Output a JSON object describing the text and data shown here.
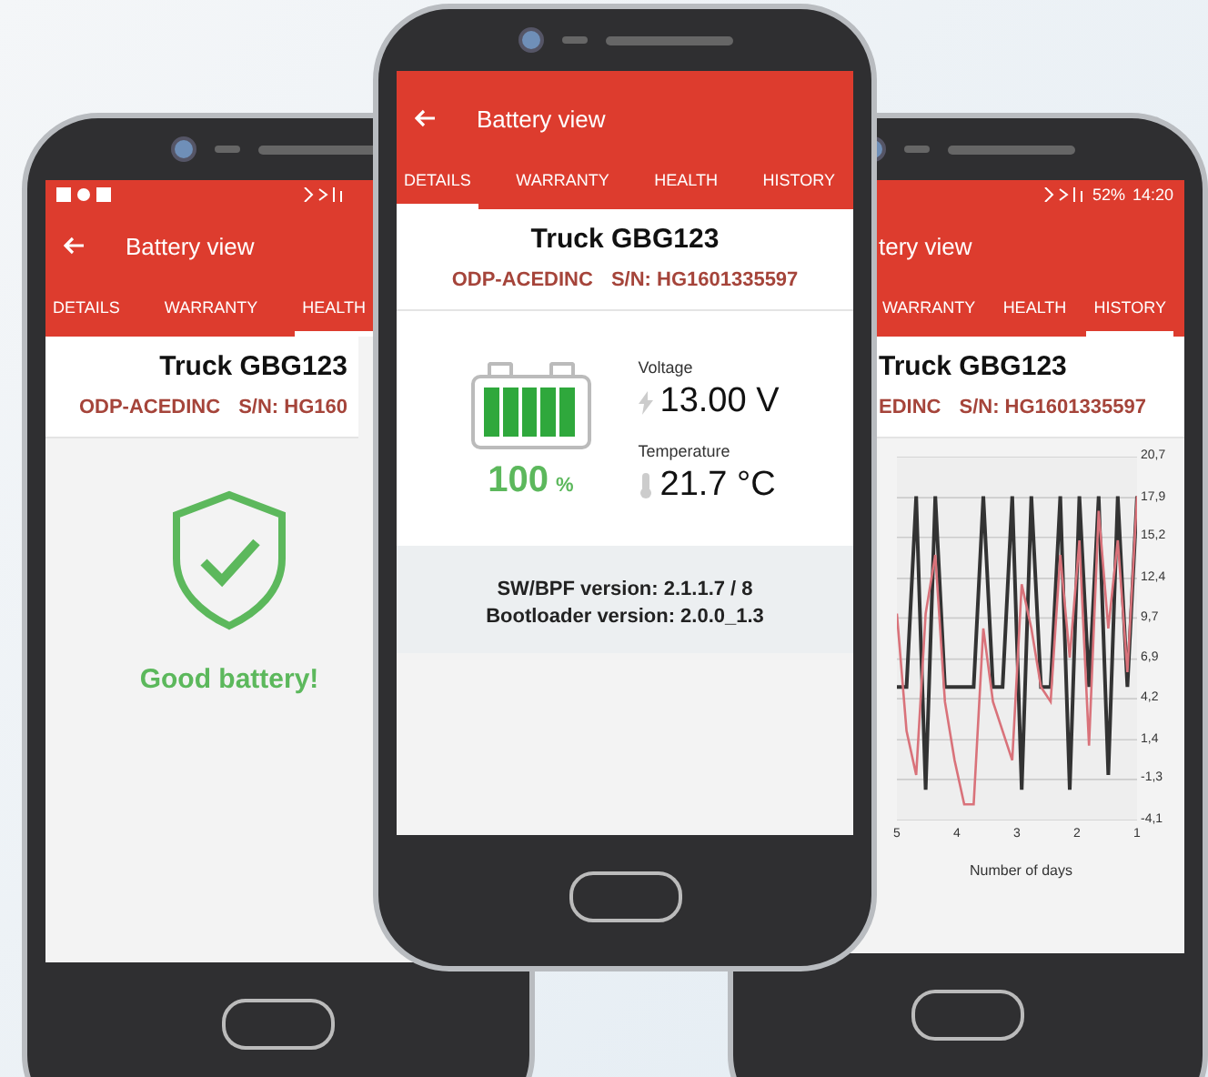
{
  "phones": [
    {
      "kind": "warranty",
      "title": "Battery view",
      "tabs": [
        {
          "label": "DETAILS",
          "selected": false
        },
        {
          "label": "WARRANTY",
          "selected": false
        },
        {
          "label": "HEALTH",
          "selected": true
        }
      ],
      "vehicle": "Truck GBG123",
      "model": "ODP-ACEDINC",
      "serial": "S/N: HG160",
      "message": "Good battery!"
    },
    {
      "kind": "details",
      "title": "Battery view",
      "tabs": [
        {
          "label": "DETAILS",
          "selected": true
        },
        {
          "label": "WARRANTY",
          "selected": false
        },
        {
          "label": "HEALTH",
          "selected": false
        },
        {
          "label": "HISTORY",
          "selected": false
        }
      ],
      "vehicle": "Truck GBG123",
      "model": "ODP-ACEDINC",
      "serial": "S/N: HG1601335597",
      "charge": "100",
      "charge_unit": "%",
      "level": 1,
      "voltage_label": "Voltage",
      "voltage": "13.00 V",
      "temperature_label": "Temperature",
      "temperature": "21.7 °C",
      "versions": [
        "SW/BPF version: 2.1.1.7 / 8",
        "Bootloader version: 2.0.0_1.3"
      ]
    },
    {
      "kind": "history",
      "title": "tery view",
      "status_texts": [
        "52%",
        "14:20"
      ],
      "tabs": [
        {
          "label": "WARRANTY",
          "selected": false
        },
        {
          "label": "HEALTH",
          "selected": false
        },
        {
          "label": "HISTORY",
          "selected": true
        }
      ],
      "vehicle": "Truck GBG123",
      "model": "EDINC",
      "serial": "S/N: HG1601335597",
      "chart_data": {
        "type": "line",
        "xlabel": "Number of days",
        "grid": true,
        "x": [
          5,
          4.84,
          4.68,
          4.52,
          4.36,
          4.2,
          4.04,
          3.88,
          3.72,
          3.56,
          3.4,
          3.24,
          3.08,
          2.92,
          2.76,
          2.6,
          2.44,
          2.28,
          2.12,
          1.96,
          1.8,
          1.64,
          1.48,
          1.32,
          1.16,
          1.0
        ],
        "series": [
          {
            "color": "#333333",
            "values": [
              5,
              5,
              18,
              -2,
              18,
              5,
              5,
              5,
              5,
              18,
              5,
              5,
              18,
              -2,
              18,
              5,
              5,
              18,
              -2,
              18,
              5,
              18,
              -1,
              18,
              5,
              18
            ]
          },
          {
            "color": "#d9727a",
            "values": [
              10,
              2,
              -1,
              10,
              14,
              4,
              0,
              -3,
              -3,
              9,
              4,
              2,
              0,
              12,
              9,
              5,
              4,
              14,
              7,
              15,
              1,
              17,
              9,
              15,
              6,
              18
            ]
          }
        ],
        "xlim": [
          5,
          1
        ],
        "ylim": [
          -4.1,
          20.7
        ],
        "xticks": [
          5,
          4,
          3,
          2,
          1
        ],
        "yticks": [
          {
            "value": 20.7,
            "label": "20,7"
          },
          {
            "value": 17.9,
            "label": "17,9"
          },
          {
            "value": 15.2,
            "label": "15,2"
          },
          {
            "value": 12.4,
            "label": "12,4"
          },
          {
            "value": 9.7,
            "label": "9,7"
          },
          {
            "value": 6.9,
            "label": "6,9"
          },
          {
            "value": 4.2,
            "label": "4,2"
          },
          {
            "value": 1.4,
            "label": "1,4"
          },
          {
            "value": -1.3,
            "label": "-1,3"
          },
          {
            "value": -4.1,
            "label": "-4,1"
          }
        ]
      }
    }
  ]
}
